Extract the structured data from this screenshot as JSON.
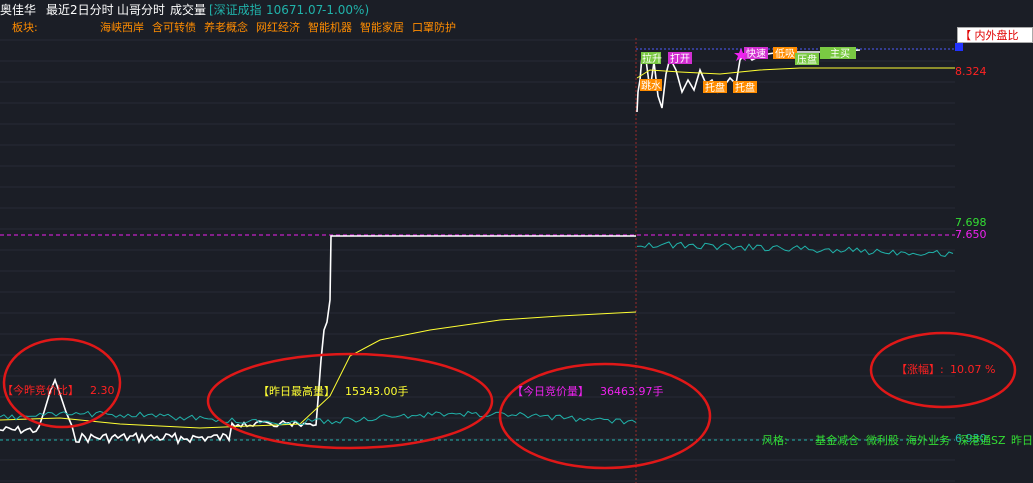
{
  "header": {
    "stock_name": "奥佳华",
    "period_label": "最近2日分时",
    "indicator_label": "山哥分时",
    "volume_label": "成交量",
    "index_bracket": "[深证成指",
    "index_value": "10671.07",
    "index_change": "-1.00%)"
  },
  "sectors": {
    "label": "板块:",
    "items": [
      "海峡西岸",
      "含可转债",
      "养老概念",
      "网红经济",
      "智能机器",
      "智能家居",
      "口罩防护"
    ]
  },
  "price_labels": {
    "upper_price": "8.324",
    "mid_price_green": "7.698",
    "mid_price_magenta": "7.650",
    "bottom_price": "6.930"
  },
  "buttons": {
    "inner_outer_ratio": "【 内外盘比"
  },
  "stats": {
    "today_vs_yesterday_label": "【今昨竞价比】",
    "today_vs_yesterday_value": "2.30",
    "yesterday_max_label": "【昨日最高量】",
    "yesterday_max_value": "15343.00手",
    "today_auction_label": "【今日竞价量】",
    "today_auction_value": "36463.97手",
    "rise_label": "【涨幅】:",
    "rise_value": "10.07 %"
  },
  "style_tags": {
    "label": "风格:",
    "items": [
      "基金减仓",
      "微利股",
      "海外业务",
      "深港通SZ",
      "昨日"
    ]
  },
  "event_labels": {
    "lark": "拉升",
    "surge": "打开",
    "dive": "跳水",
    "brush": "托盘",
    "pressure": "压盘",
    "fast_rise": "快速",
    "ladder": "低吸",
    "big_buy": "主买"
  },
  "colors": {
    "background": "#1b1e26",
    "grid": "#2e3240",
    "price_line": "#ffffff",
    "avg_line": "#ffff33",
    "cyan_line": "#20b2aa",
    "magenta": "#ee22ee",
    "red_accent": "#ff2222",
    "orange": "#ff8c00",
    "green": "#33dd33"
  }
}
